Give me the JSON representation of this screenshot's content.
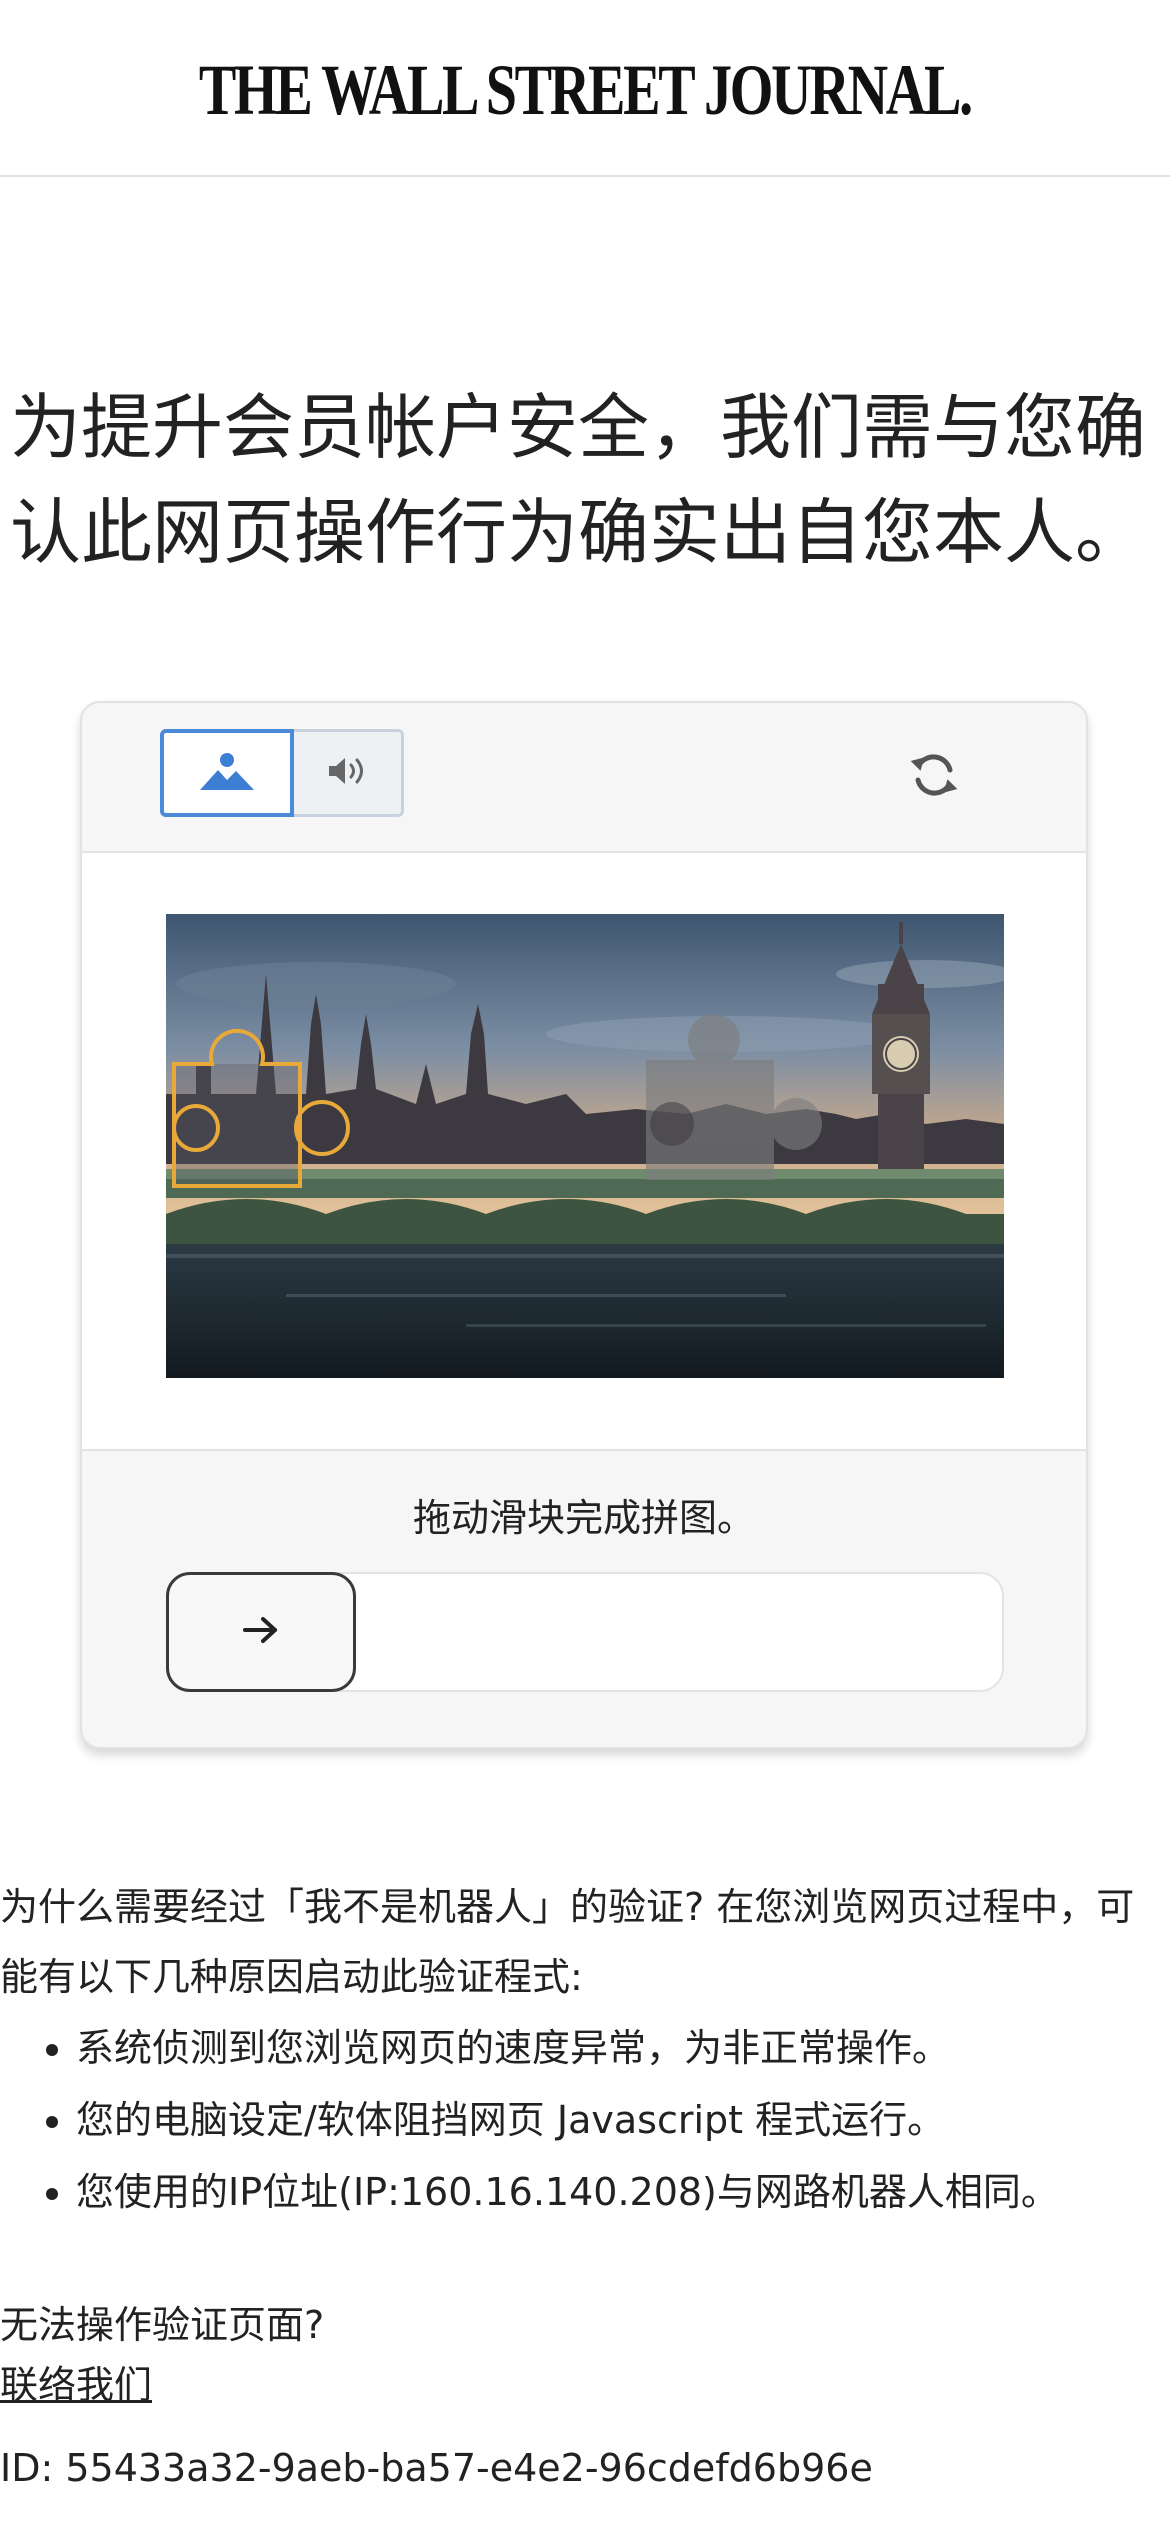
{
  "header": {
    "logo_text": "THE WALL STREET JOURNAL."
  },
  "headline": "为提升会员帐户安全，我们需与您确认此网页操作行为确实出自您本人。",
  "captcha": {
    "modes": [
      {
        "name": "image",
        "icon": "image-icon",
        "selected": true
      },
      {
        "name": "audio",
        "icon": "speaker-icon",
        "selected": false
      }
    ],
    "refresh_icon": "refresh-icon",
    "image_description_icon": "puzzle-image",
    "instruction": "拖动滑块完成拼图。",
    "slider_icon": "arrow-right-icon",
    "slider_progress": 0
  },
  "info": {
    "intro": "为什么需要经过「我不是机器人」的验证? 在您浏览网页过程中，可能有以下几种原因启动此验证程式:",
    "reasons": [
      "系统侦测到您浏览网页的速度异常，为非正常操作。",
      "您的电脑设定/软体阻挡网页 Javascript 程式运行。",
      "您使用的IP位址(IP:160.16.140.208)与网路机器人相同。"
    ]
  },
  "help": {
    "question": "无法操作验证页面?",
    "contact_link": "联络我们"
  },
  "request_id": "ID: 55433a32-9aeb-ba57-e4e2-96cdefd6b96e",
  "colors": {
    "accent": "#4a8ad8",
    "puzzle_outline": "#e8a83a"
  }
}
